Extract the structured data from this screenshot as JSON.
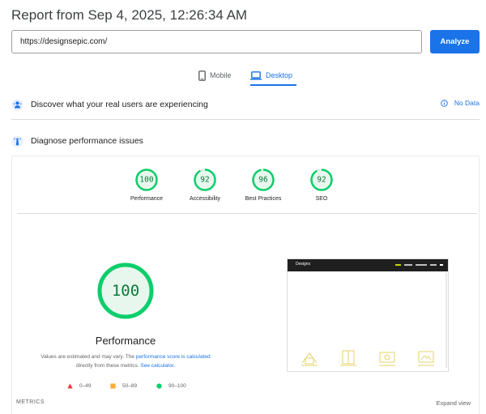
{
  "report": {
    "title": "Report from Sep 4, 2025, 12:26:34 AM"
  },
  "search": {
    "url": "https://designsepic.com/",
    "analyze_label": "Analyze"
  },
  "tabs": {
    "mobile": "Mobile",
    "desktop": "Desktop",
    "active": "desktop"
  },
  "discover": {
    "label": "Discover what your real users are experiencing",
    "status": "No Data"
  },
  "diagnose": {
    "label": "Diagnose performance issues",
    "scores": [
      {
        "label": "Performance",
        "value": 100
      },
      {
        "label": "Accessibility",
        "value": 92
      },
      {
        "label": "Best Practices",
        "value": 96
      },
      {
        "label": "SEO",
        "value": 92
      }
    ],
    "main": {
      "score": 100,
      "title": "Performance",
      "note": {
        "part1": "Values are estimated and may vary. The ",
        "link1": "performance score is calculated",
        "part2": " directly from these metrics. ",
        "link2": "See calculator",
        "part3": "."
      }
    },
    "legend": [
      {
        "range": "0–49",
        "color": "#ff3333",
        "shape": "triangle"
      },
      {
        "range": "50–89",
        "color": "#ffaa33",
        "shape": "square"
      },
      {
        "range": "90–100",
        "color": "#0cce6b",
        "shape": "circle"
      }
    ],
    "screenshot": {
      "logo_text": "Designs"
    },
    "metrics_label": "METRICS",
    "expand_label": "Expand view"
  },
  "colors": {
    "accent": "#1a73e8",
    "pass": "#0cce6b",
    "pass_text": "#0c7a3a",
    "pass_bg": "#e8f7ee"
  },
  "icons": {
    "mobile": "phone-icon",
    "desktop": "laptop-icon",
    "discover": "users-crux-icon",
    "diagnose": "lighthouse-icon",
    "nodata": "info-icon"
  }
}
